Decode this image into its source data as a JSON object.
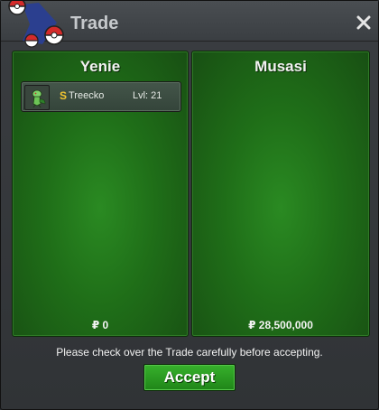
{
  "window": {
    "title": "Trade",
    "close_icon": "close-icon",
    "logo_icon": "pokeball-logo-icon"
  },
  "left_panel": {
    "name": "Yenie",
    "items": [
      {
        "icon": "treecko-sprite-icon",
        "shiny_mark": "S",
        "name": "Treecko",
        "level": "Lvl: 21"
      }
    ],
    "money": "₽ 0"
  },
  "right_panel": {
    "name": "Musasi",
    "items": [],
    "money": "₽ 28,500,000"
  },
  "footer": {
    "notice": "Please check over the Trade carefully before accepting.",
    "accept_label": "Accept"
  },
  "colors": {
    "panel_green": "#1f6e18",
    "button_green": "#2a9b22",
    "shiny_gold": "#f2c531",
    "title_gray": "#c6c9cc"
  }
}
